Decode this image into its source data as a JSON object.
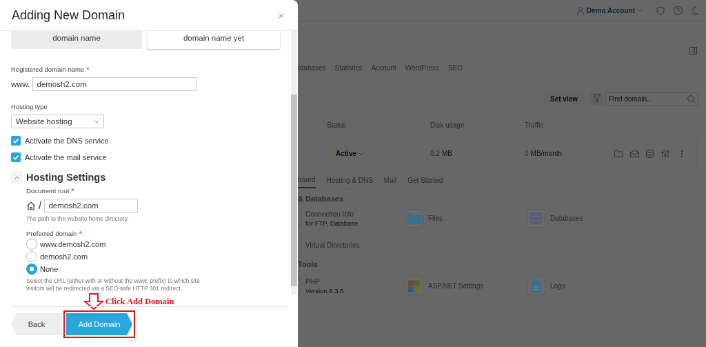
{
  "dialog": {
    "title": "Adding New Domain",
    "close_glyph": "×",
    "domain_options": [
      {
        "label": "domain name",
        "selected": true
      },
      {
        "label": "domain name yet",
        "selected": false
      }
    ],
    "registered_domain": {
      "label": "Registered domain name",
      "required_mark": "*",
      "prefix": "www.",
      "value": "demosh2.com"
    },
    "hosting_type": {
      "label": "Hosting type",
      "value": "Website hosting"
    },
    "services": [
      {
        "label": "Activate the DNS service",
        "checked": true
      },
      {
        "label": "Activate the mail service",
        "checked": true
      }
    ],
    "hosting_settings": {
      "title": "Hosting Settings",
      "expanded": true,
      "document_root": {
        "label": "Document root",
        "required_mark": "*",
        "separator": "/",
        "value": "demosh2.com",
        "hint": "The path to the website home directory."
      },
      "preferred_domain": {
        "label": "Preferred domain",
        "required_mark": "*",
        "options": [
          {
            "label": "www.demosh2.com",
            "selected": false
          },
          {
            "label": "demosh2.com",
            "selected": false
          },
          {
            "label": "None",
            "selected": true
          }
        ],
        "hint": "Select the URL (either with or without the www. prefix) to which site visitors will be redirected via a SEO-safe HTTP 301 redirect."
      }
    },
    "buttons": [
      {
        "kind": "back",
        "label": "Back"
      },
      {
        "kind": "primary",
        "label": "Add Domain"
      }
    ],
    "annotation": {
      "text": "Click Add Domain"
    }
  },
  "background": {
    "account": "Demo Account",
    "tabs": [
      "atabases",
      "Statistics",
      "Account",
      "WordPress",
      "SEO"
    ],
    "set_view": "Set view",
    "search_placeholder": "Find domain...",
    "columns": [
      "Status",
      "Disk usage",
      "Traffic"
    ],
    "row": {
      "status": "Active",
      "disk": "0.2",
      "disk_unit": "MB",
      "traffic": "0",
      "traffic_unit": "MB/month"
    },
    "subtabs": [
      {
        "label": "board",
        "selected": true
      },
      {
        "label": "Hosting & DNS",
        "selected": false
      },
      {
        "label": "Mail",
        "selected": false
      },
      {
        "label": "Get Started",
        "selected": false
      }
    ],
    "sections": [
      {
        "title": "& Databases",
        "items": [
          {
            "kind": "cut",
            "label": "Connection Info",
            "sub": "for FTP, Database"
          },
          {
            "kind": "folder",
            "label": "Files"
          },
          {
            "kind": "database",
            "label": "Databases"
          },
          {
            "kind": "cut",
            "label": "Virtual Directories"
          }
        ]
      },
      {
        "title": "Tools",
        "items": [
          {
            "kind": "cut",
            "label": "PHP",
            "sub": "Version 8.3.6"
          },
          {
            "kind": "windows",
            "label": "ASP.NET Settings"
          },
          {
            "kind": "document",
            "label": "Logs"
          }
        ]
      }
    ]
  }
}
